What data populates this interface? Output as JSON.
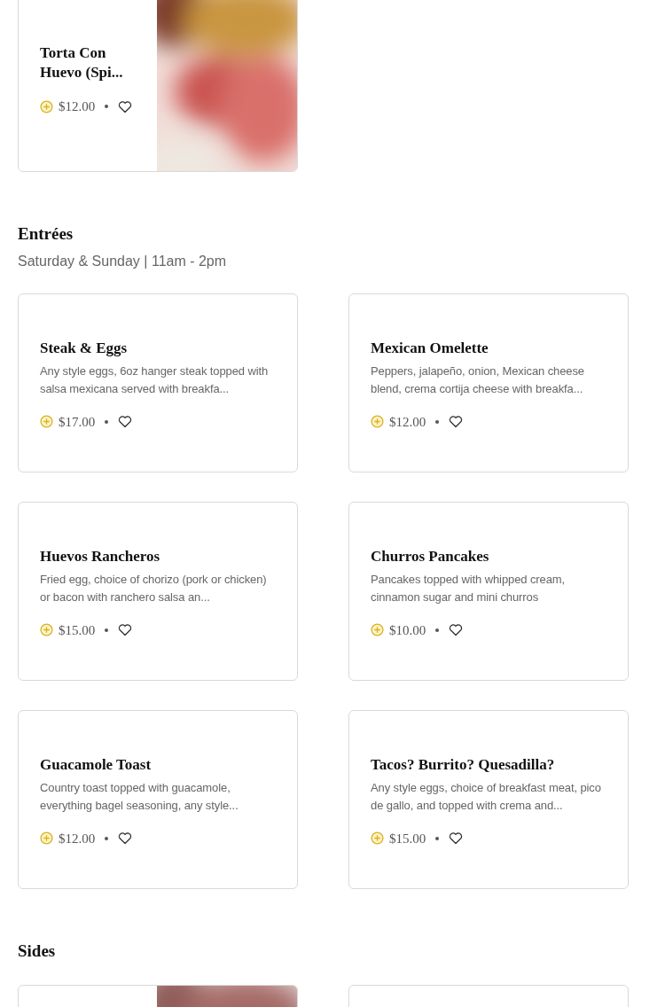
{
  "sections": [
    {
      "items": [
        {
          "kind": "picture",
          "name": "Torta Con Huevo (Spi...",
          "price": "$12.00"
        }
      ]
    },
    {
      "title": "Entrées",
      "subtitle": "Saturday & Sunday | 11am - 2pm",
      "items": [
        {
          "kind": "plain",
          "name": "Steak & Eggs",
          "description": "Any style eggs, 6oz hanger steak topped with salsa mexicana served with breakfa...",
          "price": "$17.00"
        },
        {
          "kind": "plain",
          "name": "Mexican Omelette",
          "description": "Peppers, jalapeño, onion, Mexican cheese blend, crema cortija cheese with breakfa...",
          "price": "$12.00"
        },
        {
          "kind": "plain",
          "name": "Huevos Rancheros",
          "description": "Fried egg, choice of chorizo (pork or chicken) or bacon with ranchero salsa an...",
          "price": "$15.00"
        },
        {
          "kind": "plain",
          "name": "Churros Pancakes",
          "description": "Pancakes topped with whipped cream, cinnamon sugar and mini churros",
          "price": "$10.00"
        },
        {
          "kind": "plain",
          "name": "Guacamole Toast",
          "description": "Country toast topped with guacamole, everything bagel seasoning, any style...",
          "price": "$12.00"
        },
        {
          "kind": "plain",
          "name": "Tacos? Burrito? Quesadilla?",
          "description": "Any style eggs, choice of breakfast meat, pico de gallo, and topped with crema and...",
          "price": "$15.00"
        }
      ]
    },
    {
      "title": "Sides",
      "items": [
        {
          "kind": "picture"
        },
        {
          "kind": "plain"
        }
      ]
    }
  ]
}
